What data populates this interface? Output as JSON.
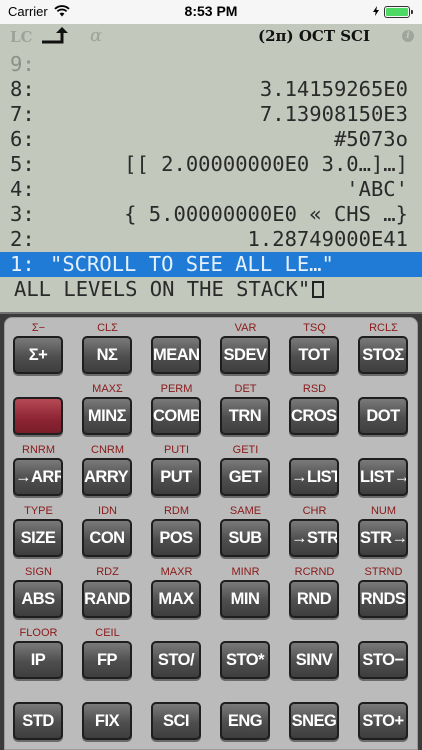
{
  "status_bar": {
    "carrier": "Carrier",
    "time": "8:53 PM",
    "battery_level": 1.0,
    "battery_color": "#4cd964"
  },
  "annunciators": {
    "lc": "LC",
    "alpha": "α",
    "modes": "(2π) OCT SCI",
    "busy_icon": "i"
  },
  "stack": [
    {
      "level": "9:",
      "value": "",
      "dimmed": true
    },
    {
      "level": "8:",
      "value": "3.14159265E0"
    },
    {
      "level": "7:",
      "value": "7.13908150E3"
    },
    {
      "level": "6:",
      "value": "#5073o"
    },
    {
      "level": "5:",
      "value": "[[ 2.00000000E0 3.0…]…]"
    },
    {
      "level": "4:",
      "value": "'ABC'"
    },
    {
      "level": "3:",
      "value": "{ 5.00000000E0 « CHS …}"
    },
    {
      "level": "2:",
      "value": "1.28749000E41"
    },
    {
      "level": "1:",
      "value": "\"SCROLL TO SEE ALL LE…\"",
      "selected": true
    },
    {
      "level": "",
      "value": "ALL LEVELS ON THE STACK\"",
      "continuation": true
    }
  ],
  "keys": [
    [
      {
        "label": "Σ+",
        "shift": "Σ−"
      },
      {
        "label": "NΣ",
        "shift": "CLΣ"
      },
      {
        "label": "MEAN",
        "shift": ""
      },
      {
        "label": "SDEV",
        "shift": "VAR"
      },
      {
        "label": "TOT",
        "shift": "TSQ"
      },
      {
        "label": "STOΣ",
        "shift": "RCLΣ"
      }
    ],
    [
      {
        "label": "",
        "shift": "",
        "red": true
      },
      {
        "label": "MINΣ",
        "shift": "MAXΣ"
      },
      {
        "label": "COMB",
        "shift": "PERM"
      },
      {
        "label": "TRN",
        "shift": "DET"
      },
      {
        "label": "CROSS",
        "shift": "RSD"
      },
      {
        "label": "DOT",
        "shift": ""
      }
    ],
    [
      {
        "label": "→ARRY",
        "shift": "RNRM"
      },
      {
        "label": "ARRY→",
        "shift": "CNRM"
      },
      {
        "label": "PUT",
        "shift": "PUTI"
      },
      {
        "label": "GET",
        "shift": "GETI"
      },
      {
        "label": "→LIST",
        "shift": ""
      },
      {
        "label": "LIST→",
        "shift": ""
      }
    ],
    [
      {
        "label": "SIZE",
        "shift": "TYPE"
      },
      {
        "label": "CON",
        "shift": "IDN"
      },
      {
        "label": "POS",
        "shift": "RDM"
      },
      {
        "label": "SUB",
        "shift": "SAME"
      },
      {
        "label": "→STR",
        "shift": "CHR"
      },
      {
        "label": "STR→",
        "shift": "NUM"
      }
    ],
    [
      {
        "label": "ABS",
        "shift": "SIGN"
      },
      {
        "label": "RAND",
        "shift": "RDZ"
      },
      {
        "label": "MAX",
        "shift": "MAXR"
      },
      {
        "label": "MIN",
        "shift": "MINR"
      },
      {
        "label": "RND",
        "shift": "RCRND"
      },
      {
        "label": "RNDS",
        "shift": "STRND"
      }
    ],
    [
      {
        "label": "IP",
        "shift": "FLOOR"
      },
      {
        "label": "FP",
        "shift": "CEIL"
      },
      {
        "label": "STO/",
        "shift": ""
      },
      {
        "label": "STO*",
        "shift": ""
      },
      {
        "label": "SINV",
        "shift": ""
      },
      {
        "label": "STO−",
        "shift": ""
      }
    ],
    [
      {
        "label": "STD",
        "shift": ""
      },
      {
        "label": "FIX",
        "shift": ""
      },
      {
        "label": "SCI",
        "shift": ""
      },
      {
        "label": "ENG",
        "shift": ""
      },
      {
        "label": "SNEG",
        "shift": ""
      },
      {
        "label": "STO+",
        "shift": ""
      }
    ]
  ],
  "colors": {
    "lcd_background": "#c2c8bc",
    "selection": "#1f7bd6",
    "shift_label": "#8a1a1a",
    "key_red": "#8c2433"
  }
}
